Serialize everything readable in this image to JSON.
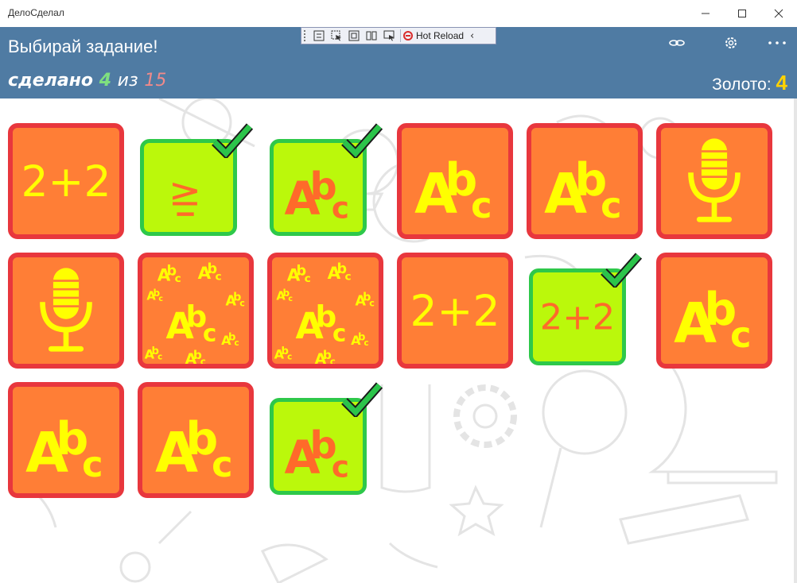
{
  "window": {
    "title": "ДелоСделал"
  },
  "header": {
    "title": "Выбирай задание!",
    "progress": {
      "prefix": "сделано",
      "done": "4",
      "of": "из",
      "total": "15"
    },
    "gold": {
      "label": "Золото:",
      "value": "4"
    }
  },
  "debug_toolbar": {
    "hot_reload": "Hot Reload"
  },
  "colors": {
    "header_bg": "#4f7ba3",
    "tile_open_fill": "#ff7e36",
    "tile_open_border": "#e8373d",
    "tile_done_fill": "#bbf80b",
    "tile_done_border": "#2ec84a",
    "glyph_open": "#ffff00",
    "glyph_done": "#ff6a2a",
    "gold_value": "#ffd200"
  },
  "tiles": [
    {
      "kind": "math",
      "text": "2+2",
      "completed": false
    },
    {
      "kind": "compare",
      "text": "≥",
      "completed": true
    },
    {
      "kind": "letters",
      "text": "Abc",
      "completed": true
    },
    {
      "kind": "letters",
      "text": "Abc",
      "completed": false
    },
    {
      "kind": "letters",
      "text": "Abc",
      "completed": false
    },
    {
      "kind": "microphone",
      "icon": "microphone-icon",
      "completed": false
    },
    {
      "kind": "microphone",
      "icon": "microphone-icon",
      "completed": false
    },
    {
      "kind": "letters-many",
      "text": "Abc",
      "completed": false
    },
    {
      "kind": "letters-many",
      "text": "Abc",
      "completed": false
    },
    {
      "kind": "math",
      "text": "2+2",
      "completed": false
    },
    {
      "kind": "math",
      "text": "2+2",
      "completed": true
    },
    {
      "kind": "letters",
      "text": "Abc",
      "completed": false
    },
    {
      "kind": "letters",
      "text": "Abc",
      "completed": false
    },
    {
      "kind": "letters",
      "text": "Abc",
      "completed": false
    },
    {
      "kind": "letters",
      "text": "Abc",
      "completed": true
    }
  ]
}
